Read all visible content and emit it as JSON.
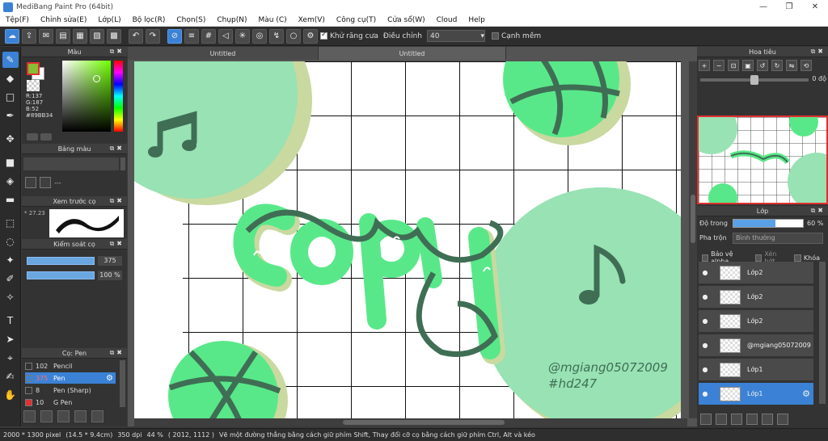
{
  "window": {
    "title": "MediBang Paint Pro (64bit)",
    "minimize": "—",
    "restore": "❐",
    "close": "✕"
  },
  "menu": [
    "Tệp(F)",
    "Chỉnh sửa(E)",
    "Lớp(L)",
    "Bộ lọc(R)",
    "Chọn(S)",
    "Chụp(N)",
    "Màu (C)",
    "Xem(V)",
    "Công cụ(T)",
    "Cửa sổ(W)",
    "Cloud",
    "Help"
  ],
  "toolbar": {
    "antialias_label": "Khử răng cưa",
    "adjust_label": "Điều chỉnh",
    "adjust_value": "40",
    "snap_label": "Cạnh mềm"
  },
  "color_panel": {
    "title": "Màu",
    "r": "R:137",
    "g": "G:187",
    "b": "B:52",
    "hex": "#89BB34",
    "fg_color": "#89bb34"
  },
  "palette_panel": {
    "title": "Bảng màu",
    "dash": "---"
  },
  "brush_preview": {
    "title": "Xem trước cọ",
    "size": "* 27.23"
  },
  "brush_control": {
    "title": "Kiểm soát cọ",
    "size_value": "375",
    "opacity_value": "100 %"
  },
  "brush_list": {
    "title": "Cọ: Pen",
    "items": [
      {
        "size": "102",
        "name": "Pencil",
        "color": "#333333"
      },
      {
        "size": "375",
        "name": "Pen",
        "color": "#3b82d6"
      },
      {
        "size": "8",
        "name": "Pen (Sharp)",
        "color": "#333333"
      },
      {
        "size": "10",
        "name": "G Pen",
        "color": "#e03030"
      }
    ]
  },
  "tabs": [
    "Untitled",
    "Untitled"
  ],
  "artwork": {
    "word": "COPY",
    "credit_handle": "@mgiang05072009",
    "credit_tag": "#hd247"
  },
  "navigator": {
    "title": "Hoa tiêu",
    "rotation": "0 độ"
  },
  "layers_panel": {
    "title": "Lớp",
    "opacity_label": "Độ trong",
    "opacity_value": "60 %",
    "blend_label": "Pha trộn",
    "blend_value": "Bình thường",
    "protect_alpha": "Bảo vệ alpha",
    "clipping": "Xén bớt",
    "lock": "Khóa",
    "layers": [
      {
        "name": "Lớp2"
      },
      {
        "name": "Lớp2"
      },
      {
        "name": "Lớp2"
      },
      {
        "name": "@mgiang05072009"
      },
      {
        "name": "Lớp1"
      },
      {
        "name": "Lớp1"
      }
    ]
  },
  "status": {
    "size": "2000 * 1300 pixel",
    "physical": "(14.5 * 9.4cm)",
    "dpi": "350 dpi",
    "zoom": "44 %",
    "coords": "( 2012, 1112 )",
    "hint": "Vẽ một đường thẳng bằng cách giữ phím Shift, Thay đổi cỡ cọ bằng cách giữ phím Ctrl, Alt và kéo"
  }
}
